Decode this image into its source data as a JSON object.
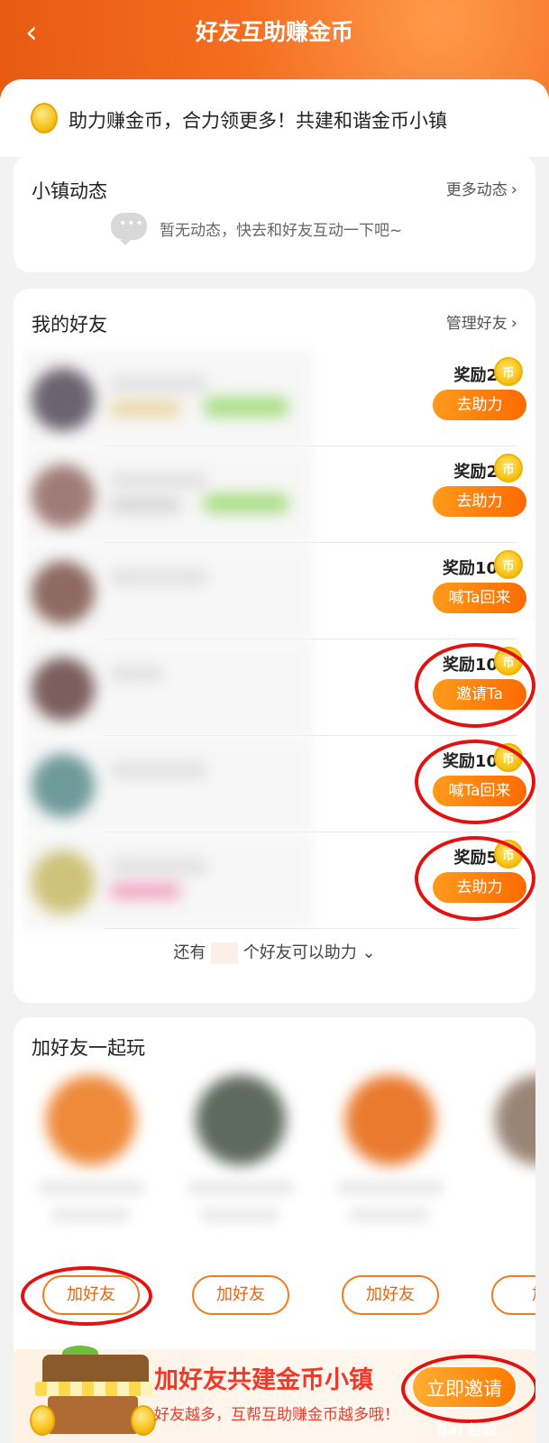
{
  "header": {
    "back_icon": "‹",
    "title": "好友互助赚金币"
  },
  "slogan": {
    "text": "助力赚金币，合力领更多！共建和谐金币小镇"
  },
  "activity": {
    "title": "小镇动态",
    "more_label": "更多动态",
    "chevron": "›",
    "empty_text": "暂无动态，快去和好友互动一下吧~"
  },
  "friends": {
    "title": "我的好友",
    "manage_label": "管理好友",
    "chevron": "›",
    "rows": [
      {
        "reward": "奖励2",
        "action": "去助力"
      },
      {
        "reward": "奖励2",
        "action": "去助力"
      },
      {
        "reward": "奖励10",
        "action": "喊Ta回来"
      },
      {
        "reward": "奖励10",
        "action": "邀请Ta"
      },
      {
        "reward": "奖励10",
        "action": "喊Ta回来"
      },
      {
        "reward": "奖励5",
        "action": "去助力"
      }
    ],
    "more_prefix": "还有",
    "more_suffix": "个好友可以助力",
    "more_chevron": "⌄"
  },
  "play": {
    "title": "加好友一起玩",
    "add_label": "加好友",
    "add_partial": "加"
  },
  "banner": {
    "title": "加好友共建金币小镇",
    "subtitle": "好友越多，互帮互助赚金币越多哦！",
    "invite_label": "立即邀请",
    "watermark": "Bai 经验"
  },
  "colors": {
    "header_orange": "#f46d20",
    "button_orange": "#ff7a00",
    "annotation_red": "#e41111",
    "banner_red": "#f0392a"
  }
}
